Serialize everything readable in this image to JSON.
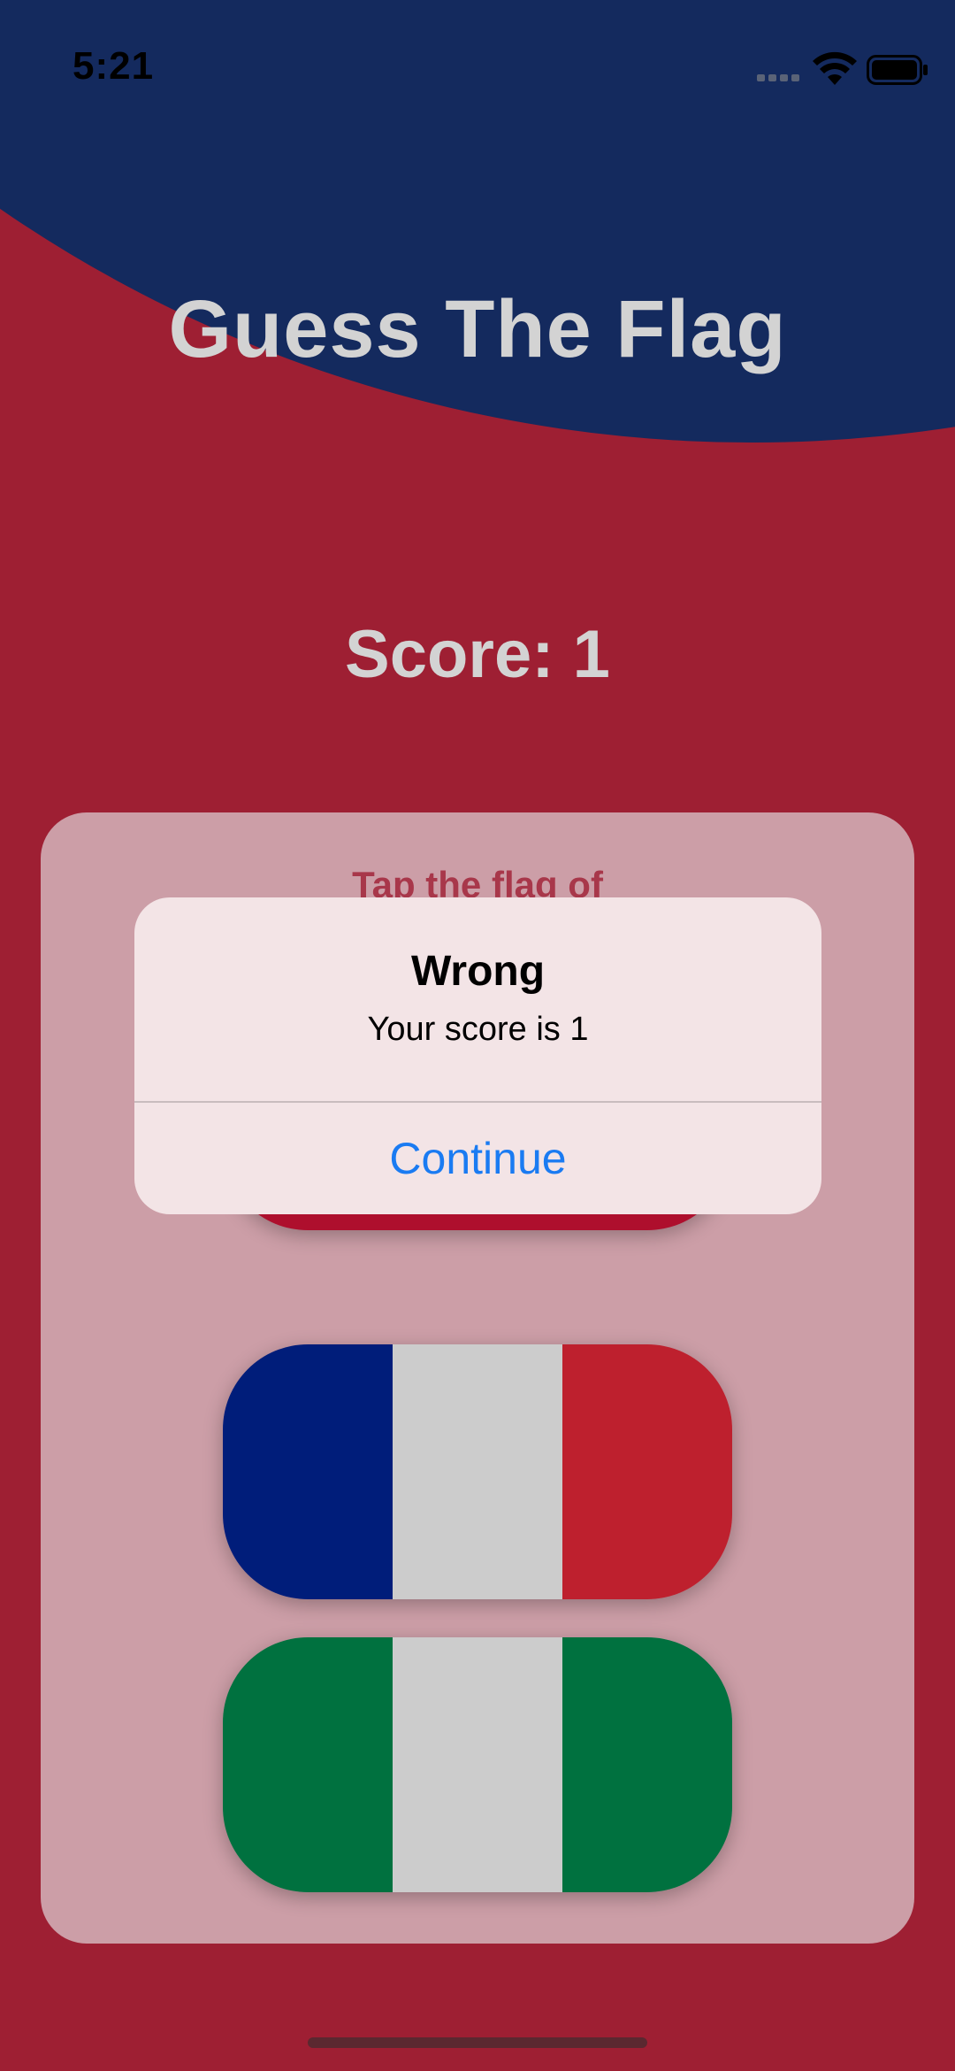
{
  "status_bar": {
    "time": "5:21"
  },
  "app": {
    "title": "Guess The Flag",
    "score_text": "Score: 1",
    "prompt_text": "Tap the flag of"
  },
  "flags": [
    {
      "name": "partially-hidden-flag",
      "colors": [
        "#c9c9c9",
        "#ae0f2d"
      ]
    },
    {
      "name": "france",
      "colors": [
        "#001d7a",
        "#cccccc",
        "#be202e"
      ]
    },
    {
      "name": "italy",
      "colors": [
        "#00713f",
        "#cccccc",
        "#00713f"
      ]
    }
  ],
  "alert": {
    "title": "Wrong",
    "message": "Your score is 1",
    "button_label": "Continue"
  },
  "colors": {
    "background_red": "#9e1f33",
    "circle_navy": "#142a5e",
    "card_pink": "#cc9ea7",
    "alert_bg": "#f3e4e6",
    "accent_blue": "#1a7bf2"
  },
  "icons": {
    "signal": "cellular-signal-icon",
    "wifi": "wifi-icon",
    "battery": "battery-icon"
  }
}
